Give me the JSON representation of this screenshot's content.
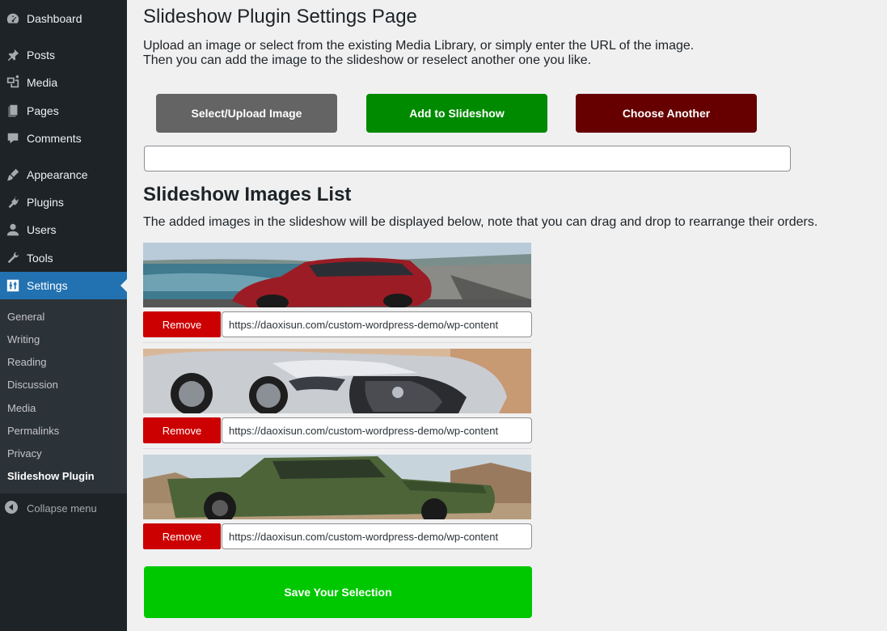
{
  "sidebar": {
    "menu": [
      {
        "label": "Dashboard",
        "icon": "dashboard-icon"
      },
      {
        "label": "Posts",
        "icon": "pin-icon"
      },
      {
        "label": "Media",
        "icon": "media-icon"
      },
      {
        "label": "Pages",
        "icon": "pages-icon"
      },
      {
        "label": "Comments",
        "icon": "comment-icon"
      },
      {
        "label": "Appearance",
        "icon": "brush-icon"
      },
      {
        "label": "Plugins",
        "icon": "plug-icon"
      },
      {
        "label": "Users",
        "icon": "user-icon"
      },
      {
        "label": "Tools",
        "icon": "wrench-icon"
      },
      {
        "label": "Settings",
        "icon": "settings-icon",
        "active": true
      }
    ],
    "submenu": [
      "General",
      "Writing",
      "Reading",
      "Discussion",
      "Media",
      "Permalinks",
      "Privacy",
      "Slideshow Plugin"
    ],
    "current_submenu": "Slideshow Plugin",
    "collapse_label": "Collapse menu",
    "colors": {
      "bg": "#1d2327",
      "active": "#2271b1",
      "submenu_bg": "#2c3338"
    }
  },
  "main": {
    "title": "Slideshow Plugin Settings Page",
    "intro_line1": "Upload an image or select from the existing Media Library, or simply enter the URL of the image.",
    "intro_line2": "Then you can add the image to the slideshow or reselect another one you like.",
    "buttons": {
      "select": "Select/Upload Image",
      "add": "Add to Slideshow",
      "choose": "Choose Another"
    },
    "url_input_value": "",
    "list_title": "Slideshow Images List",
    "list_desc": "The added images in the slideshow will be displayed below, note that you can drag and drop to rearrange their orders.",
    "slides": [
      {
        "remove_label": "Remove",
        "url": "https://daoxisun.com/custom-wordpress-demo/wp-content",
        "image": "red porsche car by the sea"
      },
      {
        "remove_label": "Remove",
        "url": "https://daoxisun.com/custom-wordpress-demo/wp-content",
        "image": "silver lexus car front"
      },
      {
        "remove_label": "Remove",
        "url": "https://daoxisun.com/custom-wordpress-demo/wp-content",
        "image": "green toyota pickup truck"
      }
    ],
    "save_label": "Save Your Selection",
    "colors": {
      "select": "#646464",
      "add": "#008a00",
      "choose": "#660000",
      "remove": "#cc0000",
      "save": "#00c800"
    }
  }
}
